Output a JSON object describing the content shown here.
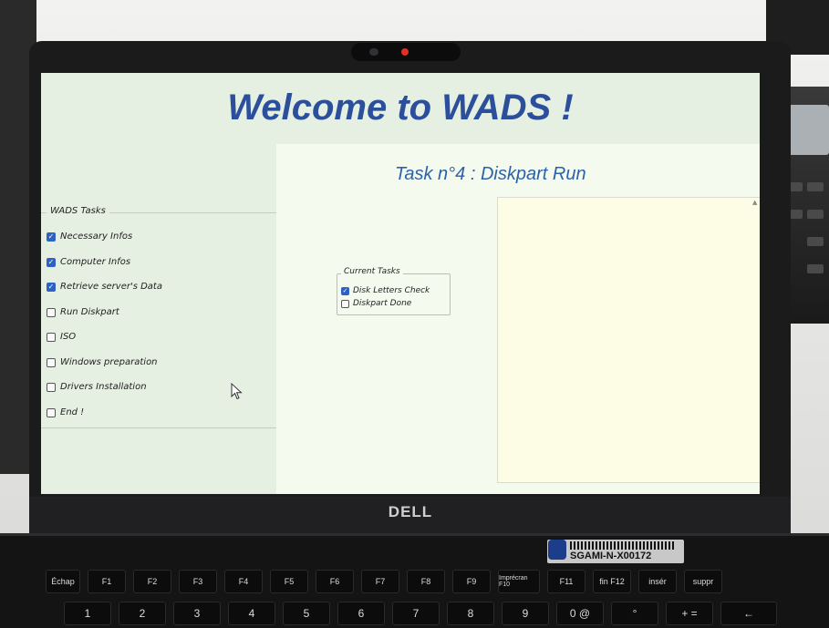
{
  "app": {
    "title": "Welcome to WADS !"
  },
  "sidebar": {
    "legend": "WADS Tasks",
    "items": [
      {
        "label": "Necessary Infos",
        "checked": true
      },
      {
        "label": "Computer Infos",
        "checked": true
      },
      {
        "label": "Retrieve server's Data",
        "checked": true
      },
      {
        "label": "Run Diskpart",
        "checked": false
      },
      {
        "label": "ISO",
        "checked": false
      },
      {
        "label": "Windows preparation",
        "checked": false
      },
      {
        "label": "Drivers Installation",
        "checked": false
      },
      {
        "label": "End !",
        "checked": false
      }
    ]
  },
  "main": {
    "task_title": "Task n°4 : Diskpart Run",
    "current_tasks": {
      "legend": "Current Tasks",
      "items": [
        {
          "label": "Disk Letters Check",
          "checked": true
        },
        {
          "label": "Diskpart Done",
          "checked": false
        }
      ]
    },
    "log_output": ""
  },
  "hardware": {
    "brand": "DELL",
    "asset_tag": "SGAMI-N-X00172"
  },
  "keyboard": {
    "row1": [
      "Échap",
      "F1",
      "F2",
      "F3",
      "F4",
      "F5",
      "F6",
      "F7",
      "F8",
      "F9",
      "Imprécran F10",
      "F11",
      "fin F12",
      "insér",
      "suppr"
    ],
    "row2": [
      "1",
      "2",
      "3",
      "4",
      "5",
      "6",
      "7",
      "8",
      "9",
      "0 @",
      "°",
      "+ =",
      "←"
    ]
  },
  "colors": {
    "title": "#2c4f9c",
    "task_title": "#2b62a8",
    "checkbox_checked": "#2d62c4",
    "screen_bg": "#e6f0e2",
    "main_bg": "#f5faef",
    "log_bg": "#fdfde6"
  }
}
